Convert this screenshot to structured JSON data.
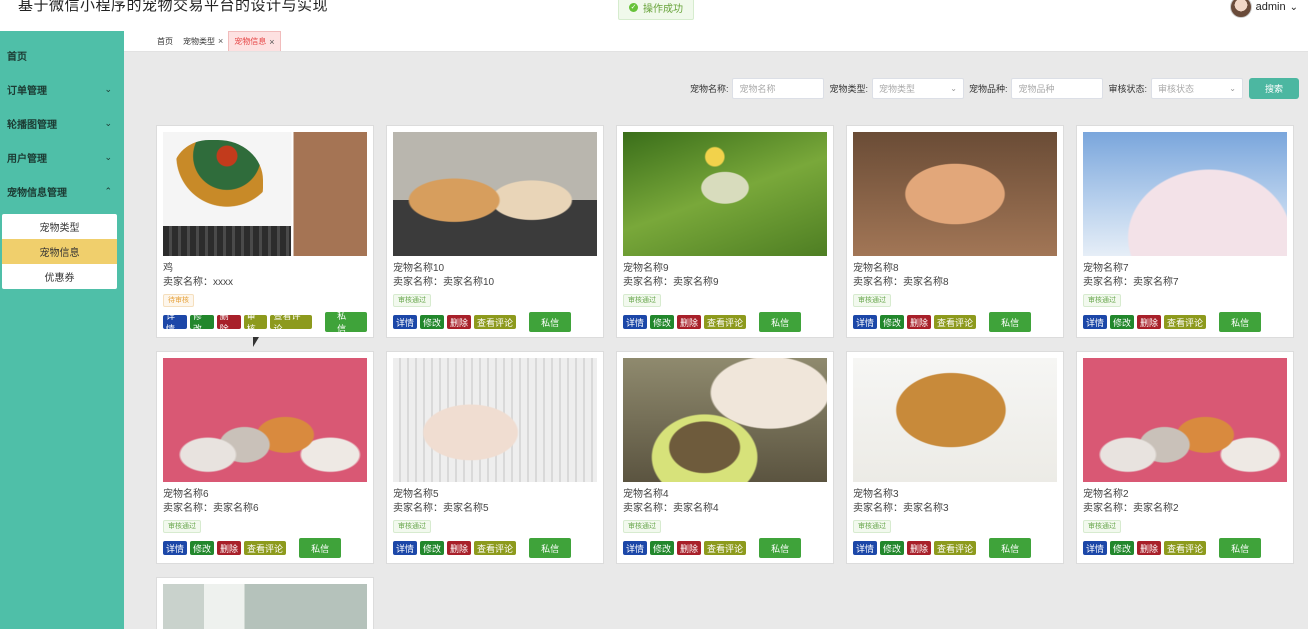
{
  "app": {
    "title": "基于微信小程序的宠物交易平台的设计与实现"
  },
  "toast": {
    "message": "操作成功"
  },
  "user": {
    "name": "admin"
  },
  "sidebar": {
    "items": [
      {
        "label": "首页"
      },
      {
        "label": "订单管理"
      },
      {
        "label": "轮播图管理"
      },
      {
        "label": "用户管理"
      },
      {
        "label": "宠物信息管理"
      }
    ],
    "submenu": [
      {
        "label": "宠物类型"
      },
      {
        "label": "宠物信息",
        "active": true
      },
      {
        "label": "优惠券"
      }
    ]
  },
  "tabs": [
    {
      "label": "首页"
    },
    {
      "label": "宠物类型"
    },
    {
      "label": "宠物信息",
      "active": true
    }
  ],
  "search": {
    "name_label": "宠物名称:",
    "name_placeholder": "宠物名称",
    "type_label": "宠物类型:",
    "type_placeholder": "宠物类型",
    "breed_label": "宠物品种:",
    "breed_placeholder": "宠物品种",
    "status_label": "审核状态:",
    "status_placeholder": "审核状态",
    "button": "搜索"
  },
  "buttons": {
    "detail": "详情",
    "edit": "修改",
    "delete": "删除",
    "audit": "审核",
    "reviews": "查看评论",
    "message": "私信"
  },
  "cards": [
    {
      "name": "鸡",
      "seller": "卖家名称：xxxx",
      "status": "待审核",
      "image": "rooster-collage"
    },
    {
      "name": "宠物名称10",
      "seller": "卖家名称：卖家名称10",
      "status": "审核通过",
      "image": "puppy-and-rabbit"
    },
    {
      "name": "宠物名称9",
      "seller": "卖家名称：卖家名称9",
      "status": "审核通过",
      "image": "parrot"
    },
    {
      "name": "宠物名称8",
      "seller": "卖家名称：卖家名称8",
      "status": "审核通过",
      "image": "cat"
    },
    {
      "name": "宠物名称7",
      "seller": "卖家名称：卖家名称7",
      "status": "审核通过",
      "image": "pig"
    },
    {
      "name": "宠物名称6",
      "seller": "卖家名称：卖家名称6",
      "status": "审核通过",
      "image": "dogs-and-cats"
    },
    {
      "name": "宠物名称5",
      "seller": "卖家名称：卖家名称5",
      "status": "审核通过",
      "image": "kitten"
    },
    {
      "name": "宠物名称4",
      "seller": "卖家名称：卖家名称4",
      "status": "审核通过",
      "image": "cat-eating"
    },
    {
      "name": "宠物名称3",
      "seller": "卖家名称：卖家名称3",
      "status": "审核通过",
      "image": "cat-in-basket"
    },
    {
      "name": "宠物名称2",
      "seller": "卖家名称：卖家名称2",
      "status": "审核通过",
      "image": "dogs-and-cats"
    }
  ],
  "colors": {
    "sidebar": "#4fbfa8",
    "active_menu": "#f0cf6c",
    "detail_btn": "#1c47a8",
    "edit_btn": "#22872c",
    "delete_btn": "#a8202a",
    "review_btn": "#8d9a1d",
    "message_btn": "#3fa33a"
  }
}
